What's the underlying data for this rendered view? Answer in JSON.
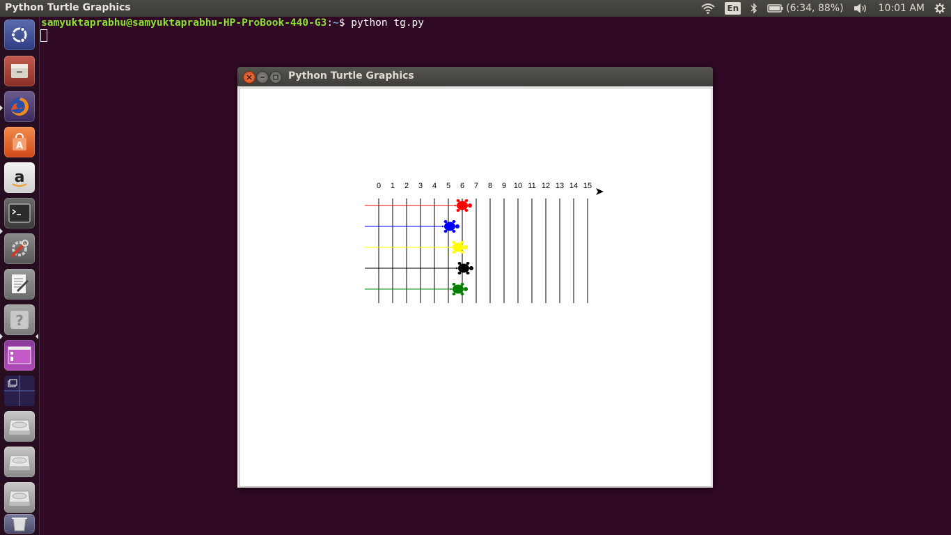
{
  "top_panel": {
    "title": "Python Turtle Graphics",
    "keyboard_layout": "En",
    "battery_text": "(6:34, 88%)",
    "clock": "10:01 AM"
  },
  "launcher": {
    "items": [
      {
        "name": "dash-home"
      },
      {
        "name": "files"
      },
      {
        "name": "firefox"
      },
      {
        "name": "ubuntu-software"
      },
      {
        "name": "amazon"
      },
      {
        "name": "terminal"
      },
      {
        "name": "system-settings"
      },
      {
        "name": "text-editor"
      },
      {
        "name": "help"
      },
      {
        "name": "image-viewer"
      },
      {
        "name": "workspace-switcher"
      },
      {
        "name": "drive-1"
      },
      {
        "name": "drive-2"
      },
      {
        "name": "drive-3"
      },
      {
        "name": "trash"
      }
    ]
  },
  "terminal": {
    "user_host": "samyuktaprabhu@samyuktaprabhu-HP-ProBook-440-G3",
    "colon": ":",
    "path": "~",
    "prompt": "$ ",
    "command": "python tg.py"
  },
  "turtle_window": {
    "title": "Python Turtle Graphics",
    "track_labels": [
      "0",
      "1",
      "2",
      "3",
      "4",
      "5",
      "6",
      "7",
      "8",
      "9",
      "10",
      "11",
      "12",
      "13",
      "14",
      "15"
    ],
    "turtles": [
      {
        "color": "#ff0000",
        "position": 6.0
      },
      {
        "color": "#0000ff",
        "position": 5.1
      },
      {
        "color": "#ffff00",
        "position": 5.7
      },
      {
        "color": "#000000",
        "position": 6.1
      },
      {
        "color": "#008000",
        "position": 5.7
      }
    ],
    "track_start": -1,
    "lane_count": 5
  }
}
